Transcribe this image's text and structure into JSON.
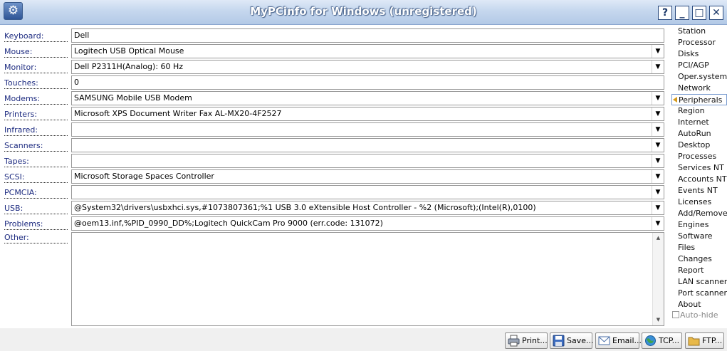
{
  "window": {
    "title": "MyPCinfo for Windows (unregistered)"
  },
  "icons": {
    "app": "gear-icon",
    "help": "?",
    "minimize": "_",
    "maximize": "□",
    "close": "✕",
    "dropdown": "▼",
    "scroll_up": "▲",
    "scroll_down": "▼"
  },
  "fields": [
    {
      "label": "Keyboard:",
      "value": "Dell",
      "dropdown": false
    },
    {
      "label": "Mouse:",
      "value": "Logitech USB Optical Mouse",
      "dropdown": true
    },
    {
      "label": "Monitor:",
      "value": "Dell P2311H(Analog): 60 Hz",
      "dropdown": true
    },
    {
      "label": "Touches:",
      "value": "0",
      "dropdown": false
    },
    {
      "label": "Modems:",
      "value": "SAMSUNG Mobile USB Modem",
      "dropdown": true
    },
    {
      "label": "Printers:",
      "value": "Microsoft XPS Document Writer   Fax   AL-MX20-4F2527",
      "dropdown": true
    },
    {
      "label": "Infrared:",
      "value": "",
      "dropdown": true
    },
    {
      "label": "Scanners:",
      "value": "",
      "dropdown": true
    },
    {
      "label": "Tapes:",
      "value": "",
      "dropdown": true
    },
    {
      "label": "SCSI:",
      "value": "Microsoft Storage Spaces Controller",
      "dropdown": true
    },
    {
      "label": "PCMCIA:",
      "value": "",
      "dropdown": true
    },
    {
      "label": "USB:",
      "value": "@System32\\drivers\\usbxhci.sys,#1073807361;%1 USB 3.0 eXtensible Host Controller - %2 (Microsoft);(Intel(R),0100)",
      "dropdown": true
    },
    {
      "label": "Problems:",
      "value": "@oem13.inf,%PID_0990_DD%;Logitech QuickCam Pro 9000 (err.code: 131072)",
      "dropdown": true
    }
  ],
  "other": {
    "label": "Other:",
    "value": ""
  },
  "sidebar": {
    "items": [
      "Station",
      "Processor",
      "Disks",
      "PCI/AGP",
      "Oper.system",
      "Network",
      "Peripherals",
      "Region",
      "Internet",
      "AutoRun",
      "Desktop",
      "Processes",
      "Services NT",
      "Accounts NT",
      "Events NT",
      "Licenses",
      "Add/Remove",
      "Engines",
      "Software",
      "Files",
      "Changes",
      "Report",
      "LAN scanner",
      "Port scanner",
      "About"
    ],
    "active": "Peripherals",
    "autohide_label": "Auto-hide",
    "autohide_checked": false
  },
  "buttons": {
    "print": "Print...",
    "save": "Save...",
    "email": "Email...",
    "tcp": "TCP...",
    "ftp": "FTP..."
  },
  "colors": {
    "label_text": "#1d2b80",
    "title_bar": "#c5d7ee",
    "active_marker": "#d59a1c"
  }
}
